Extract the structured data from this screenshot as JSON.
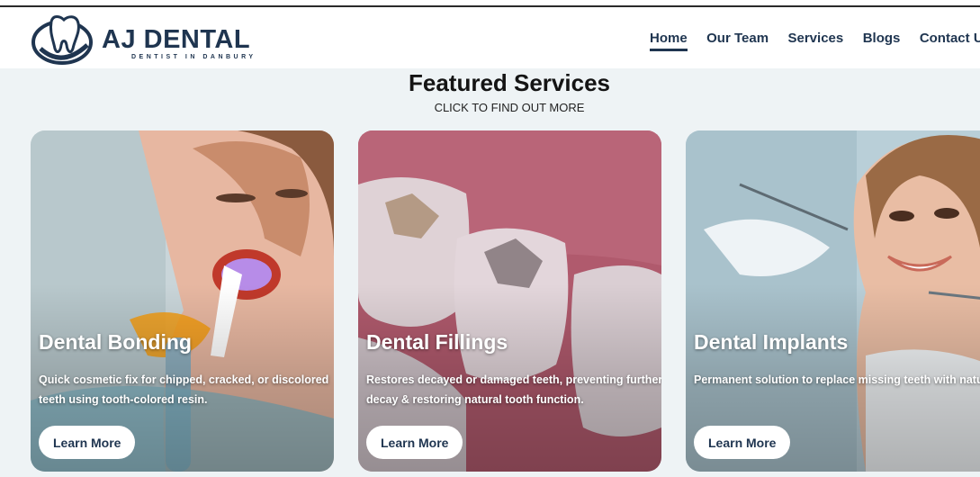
{
  "brand": {
    "name": "AJ DENTAL",
    "tagline": "DENTIST IN DANBURY",
    "primary_color": "#1f3550"
  },
  "nav": {
    "items": [
      "Home",
      "Our Team",
      "Services",
      "Blogs",
      "Contact Us"
    ],
    "active": "Home"
  },
  "section": {
    "title": "Featured Services",
    "subtitle": "CLICK TO FIND OUT MORE"
  },
  "cards": [
    {
      "title": "Dental Bonding",
      "description": "Quick cosmetic fix for chipped, cracked, or discolored teeth using tooth-colored resin.",
      "button": "Learn More",
      "image": "woman-dental-bonding-curing-light"
    },
    {
      "title": "Dental Fillings",
      "description": "Restores decayed or damaged teeth, preventing further decay & restoring natural tooth function.",
      "button": "Learn More",
      "image": "teeth-with-metal-fillings"
    },
    {
      "title": "Dental Implants",
      "description": "Permanent solution to replace missing teeth with natural-looking, titanium-supported prosthetics.",
      "button": "Learn More",
      "image": "smiling-woman-dental-exam"
    }
  ]
}
